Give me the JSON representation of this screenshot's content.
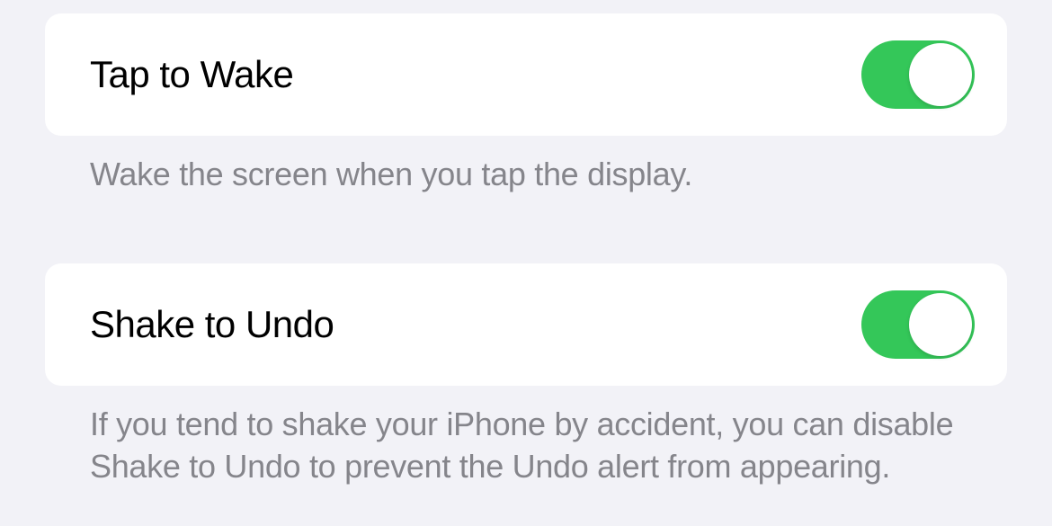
{
  "settings": {
    "tapToWake": {
      "label": "Tap to Wake",
      "description": "Wake the screen when you tap the display.",
      "enabled": true
    },
    "shakeToUndo": {
      "label": "Shake to Undo",
      "description": "If you tend to shake your iPhone by accident, you can disable Shake to Undo to prevent the Undo alert from appearing.",
      "enabled": true
    }
  }
}
